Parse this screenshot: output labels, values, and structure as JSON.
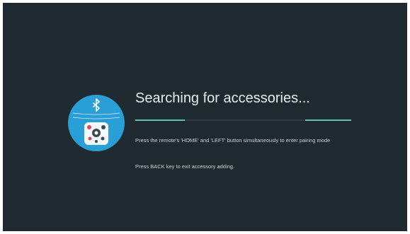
{
  "screen": {
    "title": "Searching for accessories...",
    "instruction_pairing": "Press the remote's 'HOME' and 'LEFT' button simultaneously to enter pairing mode",
    "instruction_back": "Press BACK key to exit accessory adding.",
    "progress_indicator": "indeterminate"
  },
  "illustration": {
    "icon": "bluetooth-icon",
    "remote_icon": "remote-control-icon"
  },
  "colors": {
    "background": "#1e2a2f",
    "accent": "#5fbfb2",
    "circle": "#2a9fd6",
    "text_primary": "#e6ebed",
    "text_secondary": "#c9d1d4"
  }
}
